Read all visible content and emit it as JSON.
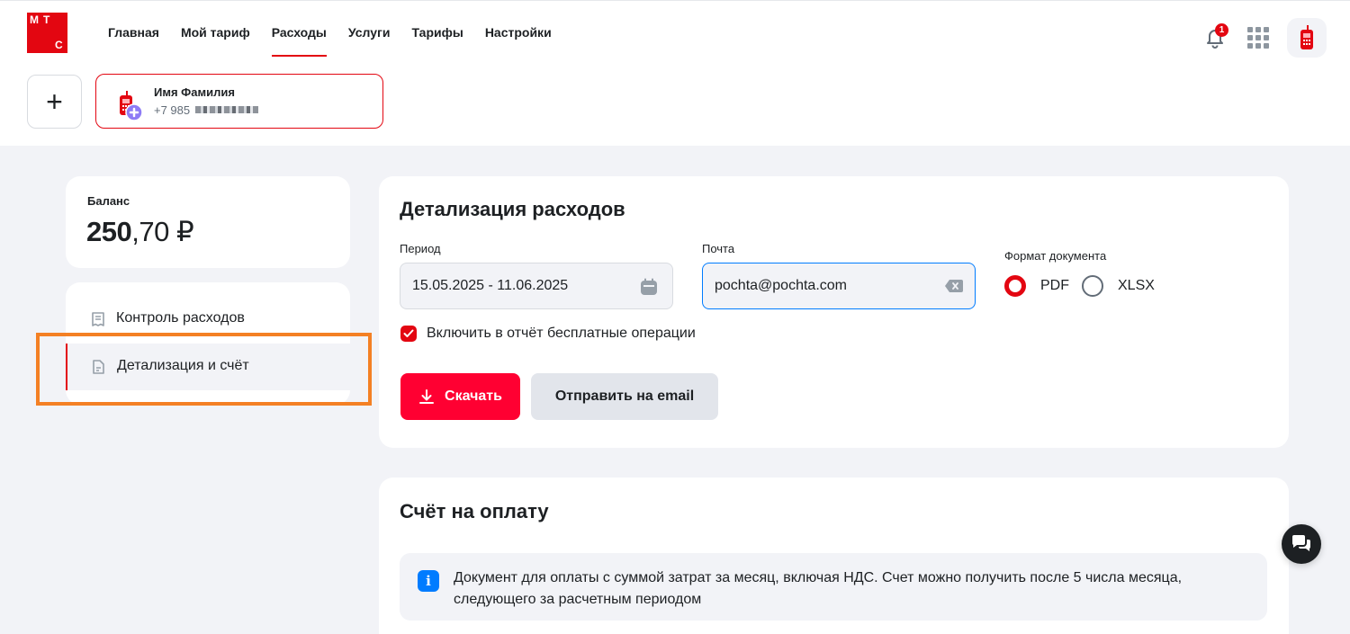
{
  "brand": {
    "logo_letters": [
      "М",
      "Т",
      "С"
    ],
    "accent_color": "#e30611"
  },
  "nav": {
    "items": [
      "Главная",
      "Мой тариф",
      "Расходы",
      "Услуги",
      "Тарифы",
      "Настройки"
    ],
    "active": "Расходы"
  },
  "header": {
    "notifications_count": "1"
  },
  "account": {
    "add_label": "+",
    "name": "Имя Фамилия",
    "number_prefix": "+7 985"
  },
  "balance": {
    "label": "Баланс",
    "integer": "250",
    "fraction": ",70 ₽"
  },
  "sidebar": {
    "items": [
      {
        "label": "Контроль расходов",
        "icon": "receipt-icon"
      },
      {
        "label": "Детализация и счёт",
        "icon": "document-icon",
        "active": true
      }
    ]
  },
  "details": {
    "title": "Детализация расходов",
    "period_label": "Период",
    "period_value": "15.05.2025 - 11.06.2025",
    "email_label": "Почта",
    "email_value": "pochta@pochta.com",
    "format_label": "Формат документа",
    "formats": [
      {
        "label": "PDF",
        "selected": true
      },
      {
        "label": "XLSX",
        "selected": false
      }
    ],
    "include_free_label": "Включить в отчёт бесплатные операции",
    "include_free_checked": true,
    "download_label": "Скачать",
    "send_email_label": "Отправить на email"
  },
  "invoice": {
    "title": "Счёт на оплату",
    "info_text": "Документ для оплаты с суммой затрат за месяц, включая НДС. Счет можно получить после 5 числа месяца, следующего за расчетным периодом"
  }
}
